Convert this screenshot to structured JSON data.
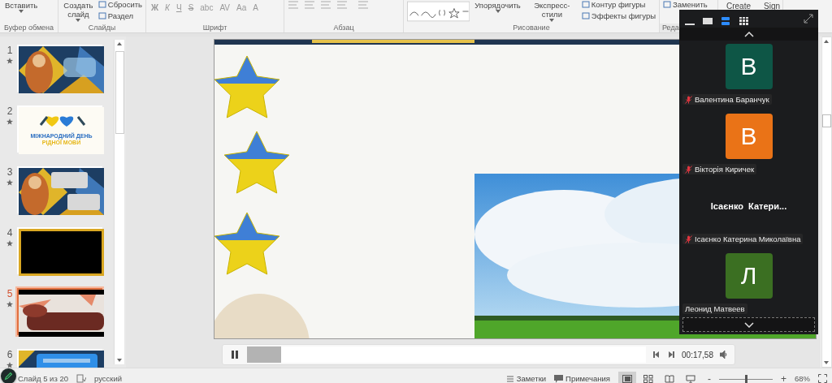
{
  "ribbon": {
    "groups": [
      {
        "kind": "clipboard",
        "label": "Буфер обмена",
        "items": [
          {
            "kind": "large",
            "label": "Вставить"
          }
        ]
      },
      {
        "kind": "slides",
        "label": "Слайды",
        "items": [
          {
            "kind": "large",
            "label": "Создать слайд"
          },
          {
            "kind": "small",
            "label": "Сбросить"
          },
          {
            "kind": "small",
            "label": "Раздел"
          }
        ]
      },
      {
        "kind": "font",
        "label": "Шрифт",
        "items": [
          {
            "kind": "glyph",
            "label": "Ж"
          },
          {
            "kind": "glyph",
            "label": "К"
          },
          {
            "kind": "glyph",
            "label": "Ч"
          },
          {
            "kind": "glyph",
            "label": "S"
          },
          {
            "kind": "glyph",
            "label": "abc"
          },
          {
            "kind": "glyph",
            "label": "AV"
          },
          {
            "kind": "glyph",
            "label": "Aa"
          },
          {
            "kind": "glyph",
            "label": "A"
          }
        ]
      },
      {
        "kind": "paragraph",
        "label": "Абзац"
      },
      {
        "kind": "drawing",
        "label": "Рисование",
        "items": [
          {
            "kind": "large",
            "label": "Упорядочить"
          },
          {
            "kind": "large",
            "label": "Экспресс-стили"
          },
          {
            "kind": "small",
            "label": "Контур фигуры"
          },
          {
            "kind": "small",
            "label": "Эффекты фигуры"
          }
        ]
      },
      {
        "kind": "editing",
        "label": "Реда",
        "items": [
          {
            "kind": "small",
            "label": "Заменить"
          }
        ]
      },
      {
        "kind": "addin",
        "items": [
          {
            "kind": "top",
            "label": "Create"
          },
          {
            "kind": "top",
            "label": "Sign"
          }
        ]
      }
    ]
  },
  "slides": [
    {
      "number": "1",
      "kind": "picture",
      "selected": false,
      "animated": true
    },
    {
      "number": "2",
      "kind": "title",
      "lines": [
        "МІЖНАРОДНИЙ ДЕНЬ",
        "РІДНОЇ МОВИ"
      ],
      "selected": false,
      "animated": true
    },
    {
      "number": "3",
      "kind": "picture",
      "selected": false,
      "animated": true
    },
    {
      "number": "4",
      "kind": "picture",
      "selected": false,
      "animated": true
    },
    {
      "number": "5",
      "kind": "picture",
      "selected": true,
      "animated": true
    },
    {
      "number": "6",
      "kind": "picture",
      "selected": false,
      "animated": true
    }
  ],
  "media": {
    "playing": true,
    "level": 0.085,
    "time": "00:17,58"
  },
  "meeting": {
    "view_modes": [
      {
        "kind": "minimize",
        "selected": false
      },
      {
        "kind": "speaker",
        "selected": false
      },
      {
        "kind": "strip",
        "selected": true
      },
      {
        "kind": "gallery",
        "selected": false
      }
    ],
    "participants": [
      {
        "kind": "avatar",
        "initial": "В",
        "color": "#0e5646",
        "name": "Валентина Баранчук",
        "muted": true
      },
      {
        "kind": "avatar",
        "initial": "В",
        "color": "#ea7317",
        "name": "Вікторія Киричек",
        "muted": true
      },
      {
        "kind": "name",
        "display_name": "Ісаєнко  Катери...",
        "name": "Ісаєнко Катерина Миколаївна",
        "muted": true
      },
      {
        "kind": "avatar",
        "initial": "Л",
        "color": "#3b6f22",
        "name": "Леонид Матвеев",
        "muted": false
      }
    ]
  },
  "status_bar": {
    "slide_counter": "Слайд 5 из 20",
    "language": "русский",
    "notes": "Заметки",
    "comments": "Примечания",
    "views": [
      {
        "kind": "normal",
        "selected": true
      },
      {
        "kind": "sorter",
        "selected": false
      },
      {
        "kind": "reading",
        "selected": false
      },
      {
        "kind": "show",
        "selected": false
      }
    ],
    "zoom": {
      "zoom_out": "-",
      "level": 0.5,
      "zoom_in": "+",
      "percent": "68%"
    }
  }
}
